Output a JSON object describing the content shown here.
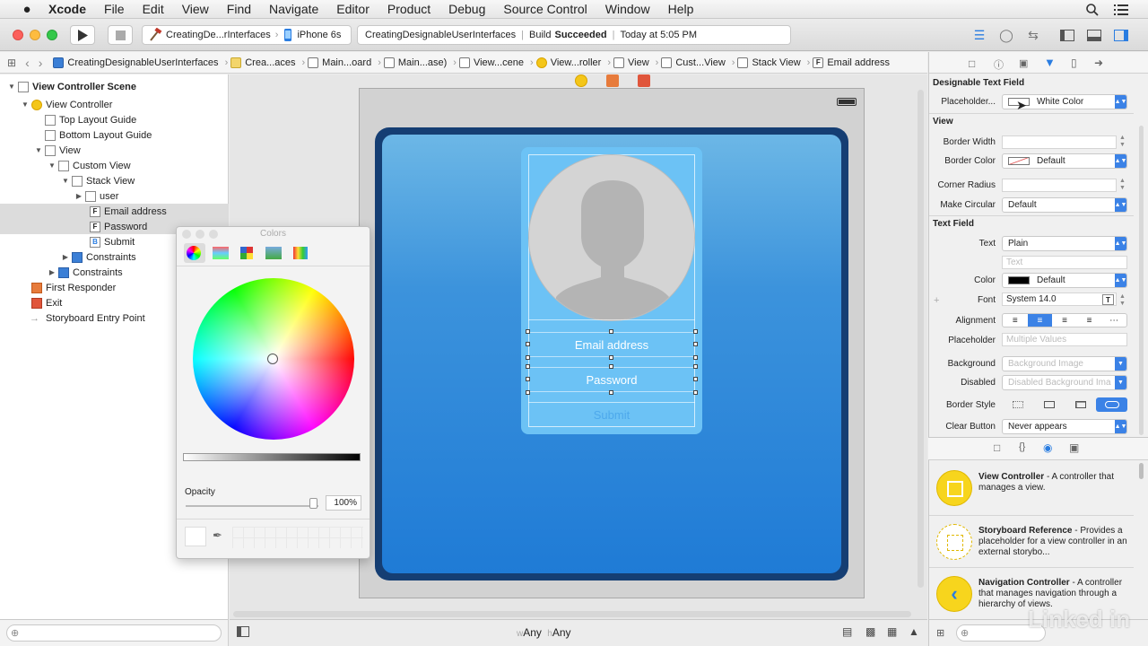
{
  "menubar": {
    "apple": "",
    "items": [
      "Xcode",
      "File",
      "Edit",
      "View",
      "Find",
      "Navigate",
      "Editor",
      "Product",
      "Debug",
      "Source Control",
      "Window",
      "Help"
    ]
  },
  "toolbar": {
    "scheme_project": "CreatingDe...rInterfaces",
    "scheme_device": "iPhone 6s",
    "status_project": "CreatingDesignableUserInterfaces",
    "status_build_prefix": "Build",
    "status_build_result": "Succeeded",
    "status_time": "Today at 5:05 PM"
  },
  "jumpbar": {
    "crumbs": [
      "CreatingDesignableUserInterfaces",
      "Crea...aces",
      "Main...oard",
      "Main...ase)",
      "View...cene",
      "View...roller",
      "View",
      "Cust...View",
      "Stack View",
      "Email address"
    ]
  },
  "outline": {
    "rows": [
      {
        "label": "View Controller Scene",
        "bold": true
      },
      {
        "label": "View Controller"
      },
      {
        "label": "Top Layout Guide"
      },
      {
        "label": "Bottom Layout Guide"
      },
      {
        "label": "View"
      },
      {
        "label": "Custom View"
      },
      {
        "label": "Stack View"
      },
      {
        "label": "user"
      },
      {
        "label": "Email address",
        "badge": "F"
      },
      {
        "label": "Password",
        "badge": "F"
      },
      {
        "label": "Submit",
        "badge": "B"
      },
      {
        "label": "Constraints"
      },
      {
        "label": "Constraints"
      },
      {
        "label": "First Responder"
      },
      {
        "label": "Exit"
      },
      {
        "label": "Storyboard Entry Point"
      }
    ]
  },
  "canvas": {
    "email_placeholder": "Email address",
    "password_placeholder": "Password",
    "submit_label": "Submit",
    "size_class_w_prefix": "w",
    "size_class_w": "Any",
    "size_class_h_prefix": "h",
    "size_class_h": "Any"
  },
  "colors_panel": {
    "title": "Colors",
    "opacity_label": "Opacity",
    "opacity_value": "100%"
  },
  "inspector": {
    "designable_section": "Designable Text Field",
    "placeholder_label": "Placeholder...",
    "placeholder_value": "White Color",
    "view_section": "View",
    "border_width_label": "Border Width",
    "border_color_label": "Border Color",
    "border_color_value": "Default",
    "corner_radius_label": "Corner Radius",
    "make_circular_label": "Make Circular",
    "make_circular_value": "Default",
    "textfield_section": "Text Field",
    "text_label": "Text",
    "text_value": "Plain",
    "text_placeholder": "Text",
    "color_label": "Color",
    "color_value": "Default",
    "font_label": "Font",
    "font_value": "System 14.0",
    "alignment_label": "Alignment",
    "placeholder2_label": "Placeholder",
    "placeholder2_value": "Multiple Values",
    "background_label": "Background",
    "background_value": "Background Image",
    "disabled_label": "Disabled",
    "disabled_value": "Disabled Background Ima",
    "border_style_label": "Border Style",
    "clear_button_label": "Clear Button",
    "clear_button_value": "Never appears"
  },
  "library": {
    "items": [
      {
        "title": "View Controller",
        "desc": " - A controller that manages a view."
      },
      {
        "title": "Storyboard Reference",
        "desc": " - Provides a placeholder for a view controller in an external storybo..."
      },
      {
        "title": "Navigation Controller",
        "desc": " - A controller that manages navigation through a hierarchy of views."
      }
    ]
  },
  "watermark": "Linked in",
  "colors": {
    "accent": "#2a7de1",
    "device_frame": "#153e73",
    "card": "#6cc2f5",
    "selection": "#3b82e6"
  }
}
